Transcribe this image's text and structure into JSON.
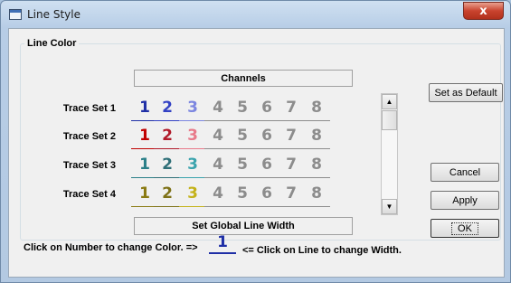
{
  "window": {
    "title": "Line Style",
    "close_glyph": "x"
  },
  "group": {
    "legend": "Line Color"
  },
  "channels_header": "Channels",
  "trace_sets": [
    {
      "label": "Trace Set 1",
      "channels": [
        {
          "num": "1",
          "color": "#1f2fa6"
        },
        {
          "num": "2",
          "color": "#3342c4"
        },
        {
          "num": "3",
          "color": "#7c86e0"
        },
        {
          "num": "4",
          "color": "#8c8c8c"
        },
        {
          "num": "5",
          "color": "#8c8c8c"
        },
        {
          "num": "6",
          "color": "#8c8c8c"
        },
        {
          "num": "7",
          "color": "#8c8c8c"
        },
        {
          "num": "8",
          "color": "#8c8c8c"
        }
      ]
    },
    {
      "label": "Trace Set 2",
      "channels": [
        {
          "num": "1",
          "color": "#c00000"
        },
        {
          "num": "2",
          "color": "#b11a2a"
        },
        {
          "num": "3",
          "color": "#e87a8a"
        },
        {
          "num": "4",
          "color": "#8c8c8c"
        },
        {
          "num": "5",
          "color": "#8c8c8c"
        },
        {
          "num": "6",
          "color": "#8c8c8c"
        },
        {
          "num": "7",
          "color": "#8c8c8c"
        },
        {
          "num": "8",
          "color": "#8c8c8c"
        }
      ]
    },
    {
      "label": "Trace Set 3",
      "channels": [
        {
          "num": "1",
          "color": "#2a7f88"
        },
        {
          "num": "2",
          "color": "#2f6f78"
        },
        {
          "num": "3",
          "color": "#3aa3ad"
        },
        {
          "num": "4",
          "color": "#8c8c8c"
        },
        {
          "num": "5",
          "color": "#8c8c8c"
        },
        {
          "num": "6",
          "color": "#8c8c8c"
        },
        {
          "num": "7",
          "color": "#8c8c8c"
        },
        {
          "num": "8",
          "color": "#8c8c8c"
        }
      ]
    },
    {
      "label": "Trace Set 4",
      "channels": [
        {
          "num": "1",
          "color": "#8a7a12"
        },
        {
          "num": "2",
          "color": "#7e7218"
        },
        {
          "num": "3",
          "color": "#c4b21a"
        },
        {
          "num": "4",
          "color": "#8c8c8c"
        },
        {
          "num": "5",
          "color": "#8c8c8c"
        },
        {
          "num": "6",
          "color": "#8c8c8c"
        },
        {
          "num": "7",
          "color": "#8c8c8c"
        },
        {
          "num": "8",
          "color": "#8c8c8c"
        }
      ]
    }
  ],
  "scrollbar": {
    "up_glyph": "▲",
    "down_glyph": "▼"
  },
  "buttons": {
    "set_default": "Set as Default",
    "cancel": "Cancel",
    "apply": "Apply",
    "ok": "OK"
  },
  "global_width_button": "Set Global Line Width",
  "footer": {
    "left_text": "Click on Number to change Color. =>",
    "width_sample": "1",
    "width_sample_color": "#1f2fa6",
    "right_text": "<= Click on Line to change Width."
  },
  "icons": {
    "title": "window-app-icon",
    "close": "close-icon",
    "scroll_up": "arrow-up-icon",
    "scroll_down": "arrow-down-icon"
  }
}
